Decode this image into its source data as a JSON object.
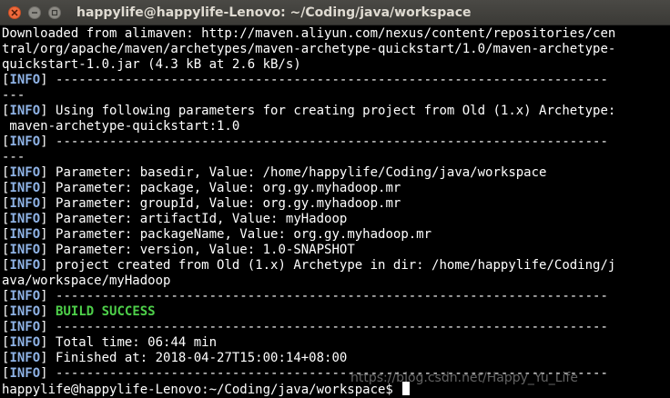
{
  "window": {
    "title": "happylife@happylife-Lenovo: ~/Coding/java/workspace"
  },
  "terminal": {
    "lines": [
      {
        "text": "Downloaded from alimaven: http://maven.aliyun.com/nexus/content/repositories/cen"
      },
      {
        "text": "tral/org/apache/maven/archetypes/maven-archetype-quickstart/1.0/maven-archetype-"
      },
      {
        "text": "quickstart-1.0.jar (4.3 kB at 2.6 kB/s)"
      },
      {
        "tag": "INFO",
        "text": " ------------------------------------------------------------------------"
      },
      {
        "text": "---"
      },
      {
        "tag": "INFO",
        "text": " Using following parameters for creating project from Old (1.x) Archetype:"
      },
      {
        "text": " maven-archetype-quickstart:1.0"
      },
      {
        "tag": "INFO",
        "text": " ------------------------------------------------------------------------"
      },
      {
        "text": "---"
      },
      {
        "tag": "INFO",
        "text": " Parameter: basedir, Value: /home/happylife/Coding/java/workspace"
      },
      {
        "tag": "INFO",
        "text": " Parameter: package, Value: org.gy.myhadoop.mr"
      },
      {
        "tag": "INFO",
        "text": " Parameter: groupId, Value: org.gy.myhadoop.mr"
      },
      {
        "tag": "INFO",
        "text": " Parameter: artifactId, Value: myHadoop"
      },
      {
        "tag": "INFO",
        "text": " Parameter: packageName, Value: org.gy.myhadoop.mr"
      },
      {
        "tag": "INFO",
        "text": " Parameter: version, Value: 1.0-SNAPSHOT"
      },
      {
        "tag": "INFO",
        "text": " project created from Old (1.x) Archetype in dir: /home/happylife/Coding/j"
      },
      {
        "text": "ava/workspace/myHadoop"
      },
      {
        "tag": "INFO",
        "text": " ------------------------------------------------------------------------"
      },
      {
        "tag": "INFO",
        "text": " ",
        "highlight": "BUILD SUCCESS"
      },
      {
        "tag": "INFO",
        "text": " ------------------------------------------------------------------------"
      },
      {
        "tag": "INFO",
        "text": " Total time: 06:44 min"
      },
      {
        "tag": "INFO",
        "text": " Finished at: 2018-04-27T15:00:14+08:00"
      },
      {
        "tag": "INFO",
        "text": " ------------------------------------------------------------------------"
      }
    ],
    "prompt": "happylife@happylife-Lenovo:~/Coding/java/workspace$ "
  },
  "watermark": "https://blog.csdn.net/Happy_Yu_Life",
  "colors": {
    "background": "#000000",
    "text": "#ffffff",
    "info_tag": "#8fb3e6",
    "success": "#4ed04a",
    "close_button": "#ef6a3c",
    "titlebar": "#3e3d39"
  },
  "icons": {
    "close": "close-icon",
    "minimize": "minimize-icon",
    "maximize": "maximize-icon"
  }
}
